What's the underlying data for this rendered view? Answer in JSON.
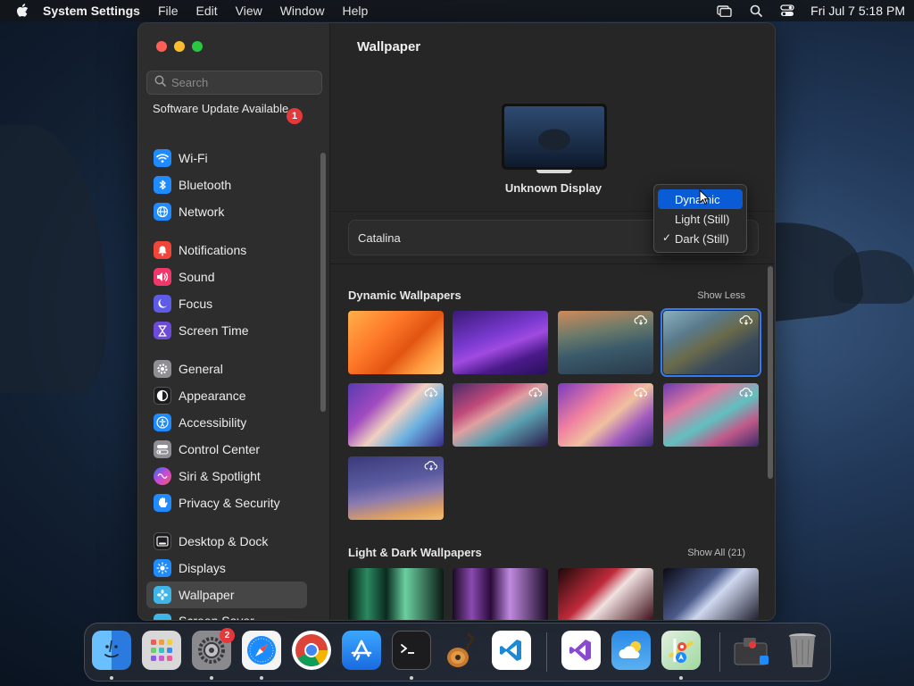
{
  "menubar": {
    "app_name": "System Settings",
    "menus": [
      "File",
      "Edit",
      "View",
      "Window",
      "Help"
    ],
    "clock": "Fri Jul 7  5:18 PM"
  },
  "sidebar": {
    "search_placeholder": "Search",
    "update_label": "Software Update Available",
    "update_badge": "1",
    "groups": [
      [
        {
          "label": "Wi-Fi",
          "icon": "wifi-icon",
          "color": "#1f8bff"
        },
        {
          "label": "Bluetooth",
          "icon": "bluetooth-icon",
          "color": "#1f8bff"
        },
        {
          "label": "Network",
          "icon": "globe-icon",
          "color": "#1f8bff"
        }
      ],
      [
        {
          "label": "Notifications",
          "icon": "bell-icon",
          "color": "#f0453a"
        },
        {
          "label": "Sound",
          "icon": "speaker-icon",
          "color": "#f0386b"
        },
        {
          "label": "Focus",
          "icon": "moon-icon",
          "color": "#5e5ce6"
        },
        {
          "label": "Screen Time",
          "icon": "hourglass-icon",
          "color": "#6c4bd8"
        }
      ],
      [
        {
          "label": "General",
          "icon": "gear-icon",
          "color": "#8e8e93"
        },
        {
          "label": "Appearance",
          "icon": "appearance-icon",
          "color": "#1c1c1e"
        },
        {
          "label": "Accessibility",
          "icon": "accessibility-icon",
          "color": "#1f8bff"
        },
        {
          "label": "Control Center",
          "icon": "toggles-icon",
          "color": "#8e8e93"
        },
        {
          "label": "Siri & Spotlight",
          "icon": "siri-icon",
          "color": "#b54fd8"
        },
        {
          "label": "Privacy & Security",
          "icon": "hand-icon",
          "color": "#1f8bff"
        }
      ],
      [
        {
          "label": "Desktop & Dock",
          "icon": "dock-icon",
          "color": "#1c1c1e"
        },
        {
          "label": "Displays",
          "icon": "sun-icon",
          "color": "#1f8bff"
        },
        {
          "label": "Wallpaper",
          "icon": "flower-icon",
          "color": "#3fb6e8",
          "selected": true
        },
        {
          "label": "Screen Saver",
          "icon": "screensaver-icon",
          "color": "#3fb6e8"
        }
      ]
    ]
  },
  "main": {
    "title": "Wallpaper",
    "display_name": "Unknown Display",
    "selected_wallpaper": "Catalina",
    "dropdown": {
      "options": [
        "Dynamic",
        "Light (Still)",
        "Dark (Still)"
      ],
      "highlighted": "Dynamic",
      "checked": "Dark (Still)"
    },
    "sections": [
      {
        "title": "Dynamic Wallpapers",
        "link": "Show Less"
      },
      {
        "title": "Light & Dark Wallpapers",
        "link": "Show All (21)"
      }
    ]
  },
  "dock": {
    "settings_badge": "2",
    "apps": [
      {
        "name": "finder-icon",
        "color": "#3a8ef0"
      },
      {
        "name": "launchpad-icon",
        "color": "#d9d9d9"
      },
      {
        "name": "system-settings-icon",
        "color": "#8e8e93"
      },
      {
        "name": "safari-icon",
        "color": "#1f8bff"
      },
      {
        "name": "chrome-icon",
        "color": "#ffffff"
      },
      {
        "name": "app-store-icon",
        "color": "#1a8cff"
      },
      {
        "name": "terminal-icon",
        "color": "#1c1c1e"
      },
      {
        "name": "garageband-icon",
        "color": "#3a2a1a"
      },
      {
        "name": "vscode-icon",
        "color": "#ffffff"
      },
      {
        "name": "visual-studio-icon",
        "color": "#ffffff"
      },
      {
        "name": "weather-icon",
        "color": "#2a7bd6"
      },
      {
        "name": "maps-icon",
        "color": "#ffffff"
      },
      {
        "name": "downloads-icon",
        "color": "#3a3a3a"
      },
      {
        "name": "trash-icon",
        "color": "#7a7a7a"
      }
    ]
  }
}
